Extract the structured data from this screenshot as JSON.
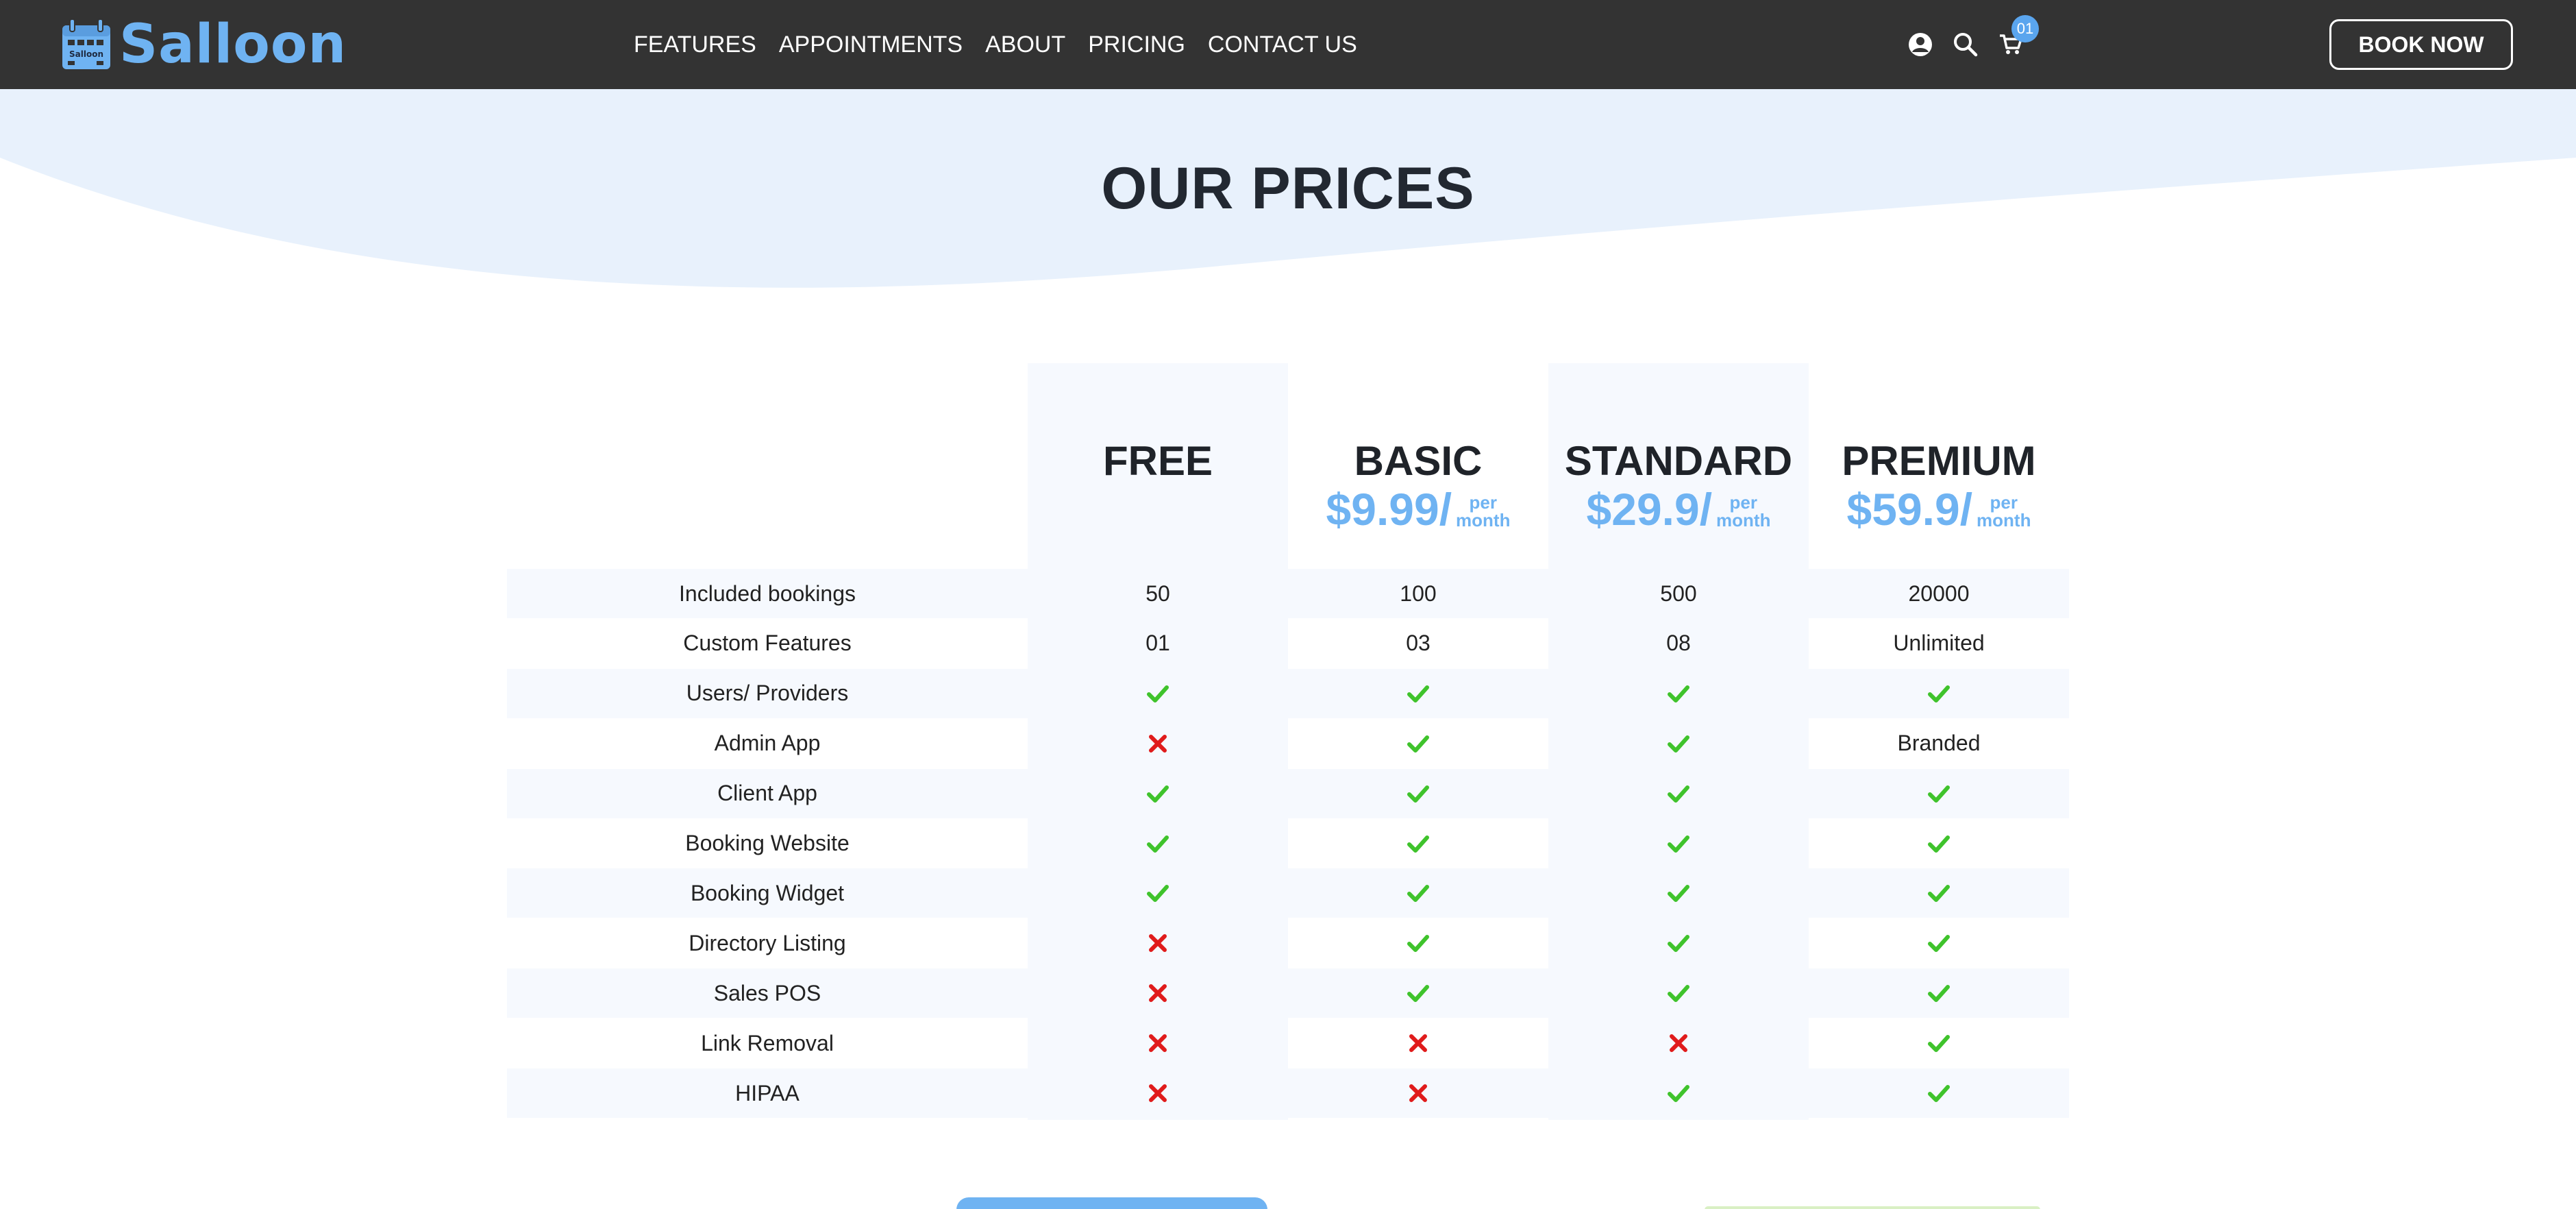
{
  "brand": {
    "name": "Salloon",
    "logo_icon": "calendar-icon",
    "logo_icon_text": "Salloon",
    "color": "#6fb3f2"
  },
  "nav": {
    "links": [
      "FEATURES",
      "APPOINTMENTS",
      "ABOUT",
      "PRICING",
      "CONTACT US"
    ],
    "icons": [
      "user-icon",
      "search-icon",
      "cart-icon"
    ],
    "cart_count": "01",
    "cta_label": "BOOK NOW",
    "bar_color": "#333333"
  },
  "hero": {
    "title": "OUR PRICES",
    "wave_color": "#e8f1fc"
  },
  "pricing": {
    "plans": [
      {
        "name": "FREE",
        "price": "",
        "per": "",
        "unit": ""
      },
      {
        "name": "BASIC",
        "price": "$9.99/",
        "per": "per",
        "unit": "month"
      },
      {
        "name": "STANDARD",
        "price": "$29.9/",
        "per": "per",
        "unit": "month"
      },
      {
        "name": "PREMIUM",
        "price": "$59.9/",
        "per": "per",
        "unit": "month"
      }
    ],
    "rows": [
      {
        "label": "Included bookings",
        "values": [
          "50",
          "100",
          "500",
          "20000"
        ]
      },
      {
        "label": "Custom Features",
        "values": [
          "01",
          "03",
          "08",
          "Unlimited"
        ]
      },
      {
        "label": "Users/ Providers",
        "values": [
          "check",
          "check",
          "check",
          "check"
        ]
      },
      {
        "label": "Admin App",
        "values": [
          "cross",
          "check",
          "check",
          "Branded"
        ]
      },
      {
        "label": "Client App",
        "values": [
          "check",
          "check",
          "check",
          "check"
        ]
      },
      {
        "label": "Booking Website",
        "values": [
          "check",
          "check",
          "check",
          "check"
        ]
      },
      {
        "label": "Booking Widget",
        "values": [
          "check",
          "check",
          "check",
          "check"
        ]
      },
      {
        "label": "Directory Listing",
        "values": [
          "cross",
          "check",
          "check",
          "check"
        ]
      },
      {
        "label": "Sales POS",
        "values": [
          "cross",
          "check",
          "check",
          "check"
        ]
      },
      {
        "label": "Link Removal",
        "values": [
          "cross",
          "cross",
          "cross",
          "check"
        ]
      },
      {
        "label": "HIPAA",
        "values": [
          "cross",
          "cross",
          "check",
          "check"
        ]
      }
    ],
    "check_color": "#3fc32c",
    "cross_color": "#e01b1b",
    "price_color": "#6fb3f2",
    "column_tint": "#f6f9fe"
  }
}
